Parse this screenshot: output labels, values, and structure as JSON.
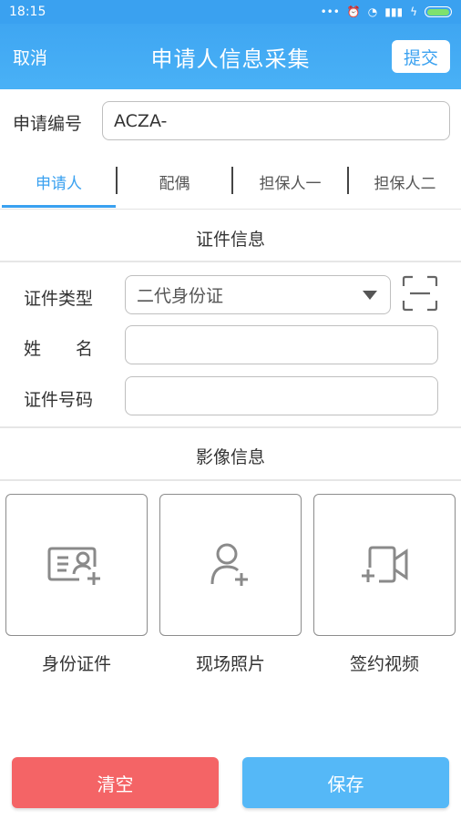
{
  "status_bar": {
    "time": "18:15"
  },
  "nav": {
    "cancel": "取消",
    "title": "申请人信息采集",
    "submit": "提交"
  },
  "application_number": {
    "label": "申请编号",
    "value": "ACZA-"
  },
  "tabs": [
    {
      "label": "申请人"
    },
    {
      "label": "配偶"
    },
    {
      "label": "担保人一"
    },
    {
      "label": "担保人二"
    }
  ],
  "id_section": {
    "title": "证件信息",
    "id_type": {
      "label": "证件类型",
      "value": "二代身份证"
    },
    "name": {
      "label": "姓　　名",
      "value": ""
    },
    "id_number": {
      "label": "证件号码",
      "value": ""
    }
  },
  "image_section": {
    "title": "影像信息",
    "tiles": [
      {
        "label": "身份证件",
        "icon": "id-card-add-icon"
      },
      {
        "label": "现场照片",
        "icon": "person-add-icon"
      },
      {
        "label": "签约视频",
        "icon": "video-add-icon"
      }
    ]
  },
  "actions": {
    "clear": "清空",
    "save": "保存"
  },
  "colors": {
    "primary": "#3aa1f0",
    "clear": "#f46466",
    "save": "#55b8f7"
  }
}
